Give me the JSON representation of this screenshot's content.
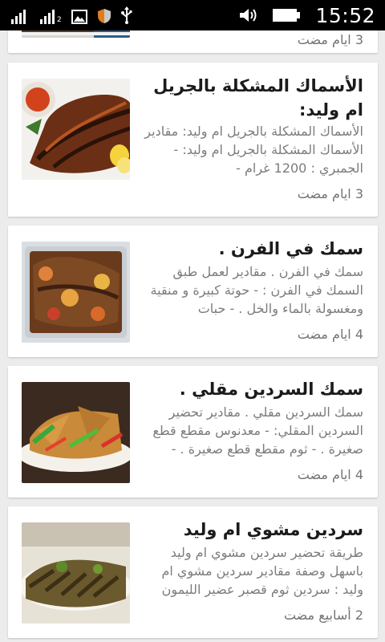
{
  "status_bar": {
    "sim_label": "2",
    "time": "15:52"
  },
  "cards": [
    {
      "title": "",
      "excerpt": "",
      "time": "3 ايام مضت"
    },
    {
      "title": "الأسماك المشكلة بالجريل ام وليد:",
      "excerpt": "الأسماك المشكلة بالجريل ام وليد: مقادير الأسماك المشكلة بالجريل ام وليد: - الجمبري : 1200 غرام -",
      "time": "3 ايام مضت"
    },
    {
      "title": "سمك في الفرن .",
      "excerpt": "سمك في الفرن . مقادير لعمل طبق السمك في الفرن : - حوتة كبيرة و منقية ومغسولة بالماء والخل . - حبات",
      "time": "4 ايام مضت"
    },
    {
      "title": "سمك السردين مقلي .",
      "excerpt": "سمك السردين مقلي . مقادير تحضير السردين المقلي: - معدنوس مقطع قطع صغيرة . - ثوم مقطع قطع صغيرة . -",
      "time": "4 ايام مضت"
    },
    {
      "title": "سردين مشوي ام وليد",
      "excerpt": "طريقة تحضير سردين مشوي ام وليد باسهل وصفة مقادير سردين مشوي ام وليد : سردين ثوم قصبر عضير الليمون",
      "time": "2 أسابيع مضت"
    }
  ]
}
